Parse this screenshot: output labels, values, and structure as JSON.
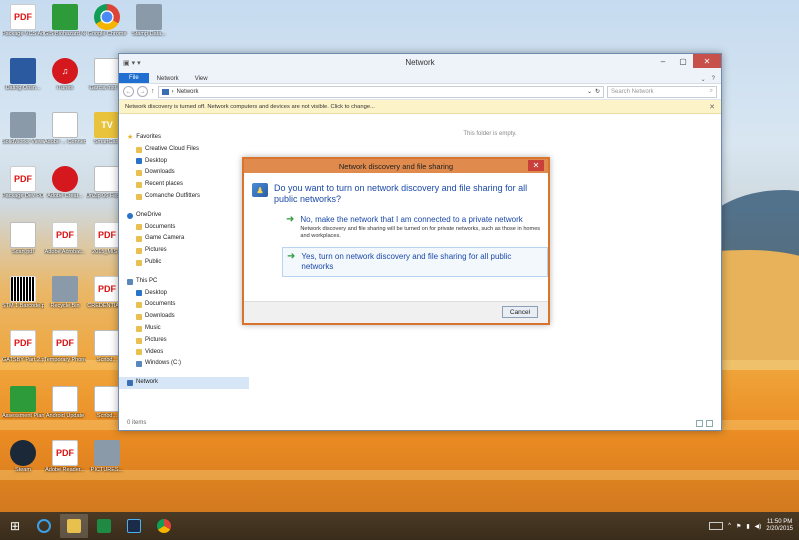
{
  "desktop": {
    "icons": [
      {
        "label": "Package VCS Ad... v1.pdf",
        "glyph": "PDF",
        "kind": "pdf"
      },
      {
        "label": "GIS Biohazard Nov 2013",
        "glyph": "",
        "kind": "green"
      },
      {
        "label": "Google Chrome",
        "glyph": "",
        "kind": "chrome"
      },
      {
        "label": "Stamp Data...",
        "glyph": "",
        "kind": "gray"
      },
      {
        "label": "Dating Onlin...",
        "glyph": "",
        "kind": "blue"
      },
      {
        "label": "iTunes",
        "glyph": "♫",
        "kind": "red"
      },
      {
        "label": "Garcia Inst TV",
        "glyph": "",
        "kind": "doc"
      },
      {
        "label": "SolidWorks Viewer",
        "glyph": "",
        "kind": "gray"
      },
      {
        "label": "Adobe ... Connect",
        "glyph": "",
        "kind": "doc"
      },
      {
        "label": "SmartCam",
        "glyph": "TV",
        "kind": "yellow"
      },
      {
        "label": "Package Dev PO 10-14.pdf",
        "glyph": "PDF",
        "kind": "pdf"
      },
      {
        "label": "Adobe Creat...",
        "glyph": "",
        "kind": "red"
      },
      {
        "label": "UnZip 06 Feb 2...",
        "glyph": "",
        "kind": "doc"
      },
      {
        "label": "Scan.pdf",
        "glyph": "",
        "kind": "doc"
      },
      {
        "label": "Adobe Acrobat...",
        "glyph": "PDF",
        "kind": "pdf"
      },
      {
        "label": "2015_MIS...",
        "glyph": "PDF",
        "kind": "pdf"
      },
      {
        "label": "STM 1 Barcode.png",
        "glyph": "",
        "kind": "barcode"
      },
      {
        "label": "Recycle Bin",
        "glyph": "",
        "kind": "gray"
      },
      {
        "label": "CREDENTIAL...",
        "glyph": "PDF",
        "kind": "pdf"
      },
      {
        "label": "GATSBY Part 2.pdf",
        "glyph": "PDF",
        "kind": "pdf"
      },
      {
        "label": "Temporary Phone Nu...",
        "glyph": "PDF",
        "kind": "pdf"
      },
      {
        "label": "Scribd...",
        "glyph": "",
        "kind": "doc"
      },
      {
        "label": "Assessment Planner",
        "glyph": "",
        "kind": "green"
      },
      {
        "label": "Android Update",
        "glyph": "",
        "kind": "doc"
      },
      {
        "label": "Scribd...",
        "glyph": "",
        "kind": "doc"
      },
      {
        "label": "Steam",
        "glyph": "",
        "kind": "steam"
      },
      {
        "label": "Adobe Reader...",
        "glyph": "PDF",
        "kind": "pdf"
      },
      {
        "label": "PICTURES...",
        "glyph": "",
        "kind": "gray"
      }
    ]
  },
  "explorer": {
    "title": "Network",
    "quick_access": [
      "▣",
      "▾",
      "▾"
    ],
    "ribbon_tabs": [
      "File",
      "Network",
      "View"
    ],
    "ribbon_right": [
      "⌄",
      "?"
    ],
    "nav_back": "←",
    "nav_forward": "→",
    "nav_up": "↑",
    "address": "Network",
    "address_prefix": "›",
    "address_chev": "⌄",
    "refresh": "↻",
    "search_placeholder": "Search Network",
    "search_icon": "⌕",
    "info_bar": "Network discovery is turned off. Network computers and devices are not visible. Click to change...",
    "info_close": "✕",
    "empty_text": "This folder is empty.",
    "status_items": "0 items",
    "navpane": [
      {
        "label": "Favorites",
        "icon": "star",
        "level": 0
      },
      {
        "label": "Creative Cloud Files",
        "icon": "folder",
        "level": 1
      },
      {
        "label": "Desktop",
        "icon": "blue",
        "level": 1
      },
      {
        "label": "Downloads",
        "icon": "folder",
        "level": 1
      },
      {
        "label": "Recent places",
        "icon": "folder",
        "level": 1
      },
      {
        "label": "Comanche Outfitters",
        "icon": "folder",
        "level": 1
      },
      {
        "label": "OneDrive",
        "icon": "cloud",
        "level": 0,
        "gap": true
      },
      {
        "label": "Documents",
        "icon": "folder",
        "level": 1
      },
      {
        "label": "Game Camera",
        "icon": "folder",
        "level": 1
      },
      {
        "label": "Pictures",
        "icon": "folder",
        "level": 1
      },
      {
        "label": "Public",
        "icon": "folder",
        "level": 1
      },
      {
        "label": "This PC",
        "icon": "pc",
        "level": 0,
        "gap": true
      },
      {
        "label": "Desktop",
        "icon": "blue",
        "level": 1
      },
      {
        "label": "Documents",
        "icon": "folder",
        "level": 1
      },
      {
        "label": "Downloads",
        "icon": "folder",
        "level": 1
      },
      {
        "label": "Music",
        "icon": "folder",
        "level": 1
      },
      {
        "label": "Pictures",
        "icon": "folder",
        "level": 1
      },
      {
        "label": "Videos",
        "icon": "folder",
        "level": 1
      },
      {
        "label": "Windows (C:)",
        "icon": "pc",
        "level": 1
      },
      {
        "label": "Network",
        "icon": "net",
        "level": 0,
        "gap": true,
        "selected": true
      }
    ]
  },
  "dialog": {
    "title": "Network discovery and file sharing",
    "close": "✕",
    "question": "Do you want to turn on network discovery and file sharing for all public networks?",
    "option1_title": "No, make the network that I am connected to a private network",
    "option1_desc": "Network discovery and file sharing will be turned on for private networks, such as those in homes and workplaces.",
    "option2_title": "Yes, turn on network discovery and file sharing for all public networks",
    "arrow": "➜",
    "cancel": "Cancel"
  },
  "taskbar": {
    "start": "⊞",
    "clock_time": "11:50 PM",
    "clock_date": "2/20/2015"
  },
  "colors": {
    "dialog_accent": "#d9742e",
    "link_blue": "#1b4aa8",
    "file_tab": "#1e6fd1"
  }
}
